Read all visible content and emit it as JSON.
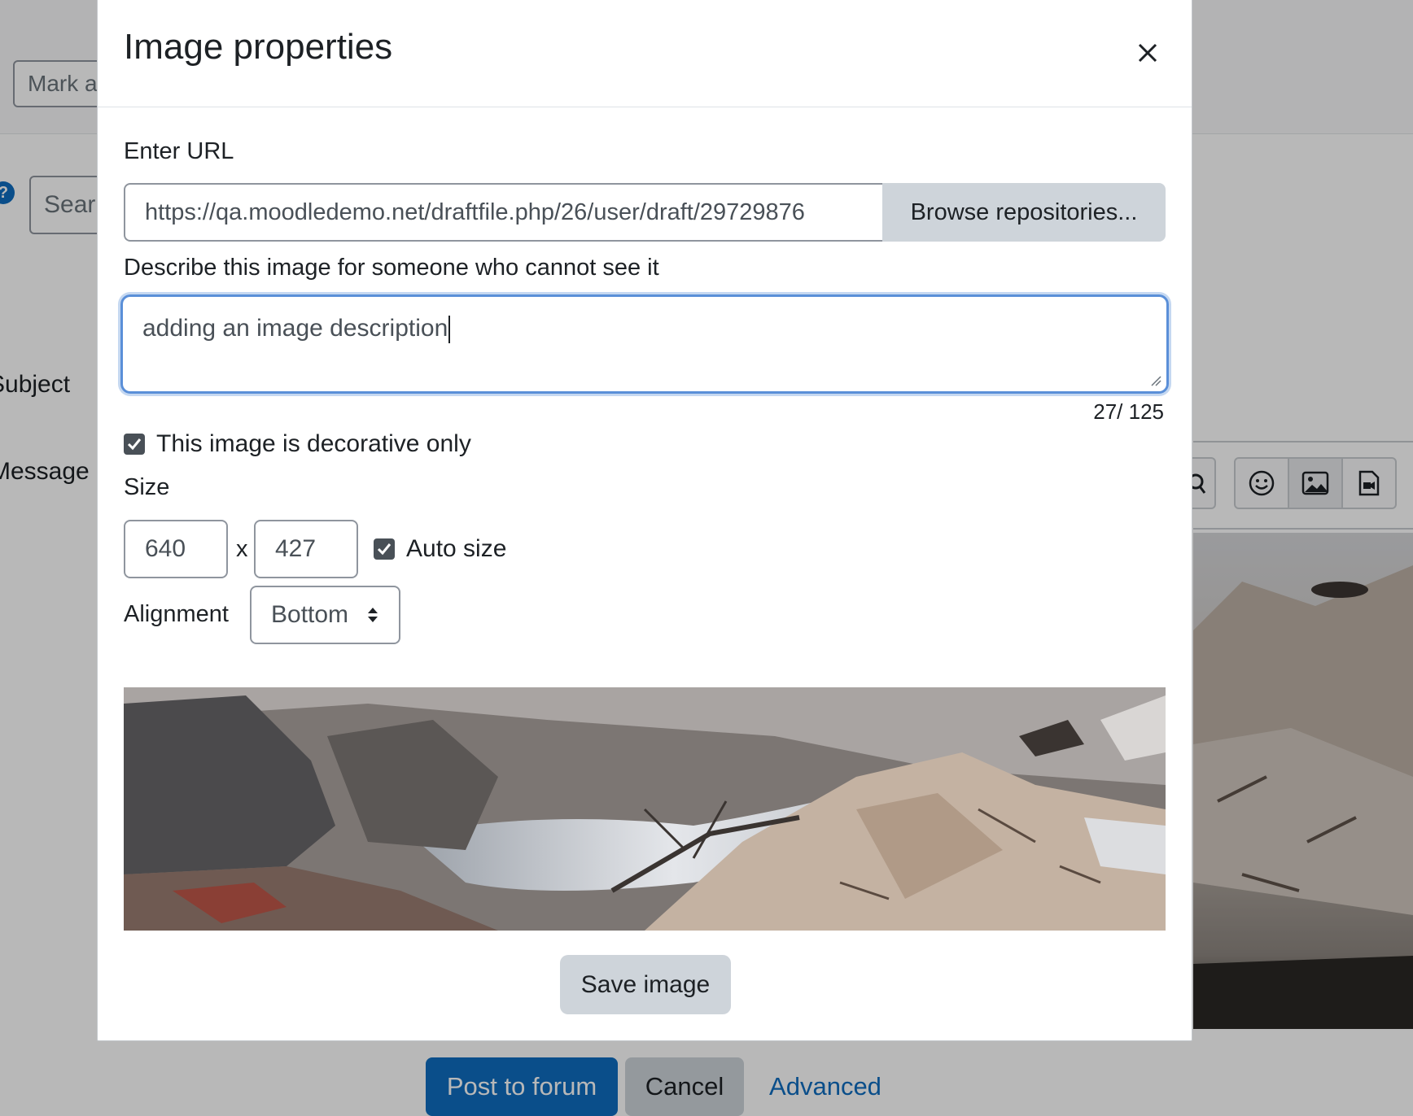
{
  "background": {
    "mark_input_text": "Mark a",
    "search_input_text": "Sear",
    "help_icon_glyph": "?",
    "subject_label": "Subject",
    "message_label": "Message",
    "toolbar_icons": [
      "search-replace-icon",
      "emoji-icon",
      "image-icon",
      "media-icon"
    ],
    "footer": {
      "post_label": "Post to forum",
      "cancel_label": "Cancel",
      "advanced_label": "Advanced"
    }
  },
  "modal": {
    "title": "Image properties",
    "close_icon": "close-icon",
    "url_label": "Enter URL",
    "url_value": "https://qa.moodledemo.net/draftfile.php/26/user/draft/29729876",
    "browse_label": "Browse repositories...",
    "description_label": "Describe this image for someone who cannot see it",
    "description_value": "adding an image description",
    "char_counter": "27/ 125",
    "decorative_label": "This image is decorative only",
    "decorative_checked": true,
    "size_label": "Size",
    "width_value": "640",
    "size_separator": "x",
    "height_value": "427",
    "autosize_label": "Auto size",
    "autosize_checked": true,
    "alignment_label": "Alignment",
    "alignment_value": "Bottom",
    "save_label": "Save image"
  },
  "colors": {
    "primary": "#0f6cbf",
    "focus_ring": "#5a8fd8",
    "secondary_button": "#ced4da",
    "overlay": "rgba(0,0,0,0.28)"
  }
}
